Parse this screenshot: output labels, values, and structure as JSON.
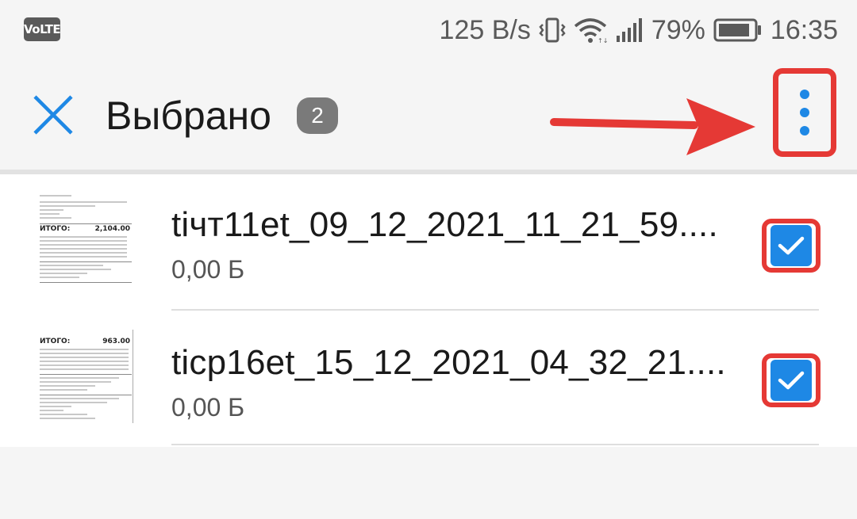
{
  "status_bar": {
    "volte": "VoLTE",
    "net_speed": "125 B/s",
    "battery_percent": "79%",
    "time": "16:35",
    "icons": [
      "vibrate-icon",
      "wifi-icon",
      "signal-icon",
      "battery-icon"
    ]
  },
  "toolbar": {
    "close_icon": "close-icon",
    "title": "Выбрано",
    "selected_count": "2",
    "more_icon": "more-vertical-icon",
    "annotation": "red-arrow-pointing-to-more-menu"
  },
  "files": [
    {
      "name": "tiчт11et_09_12_2021_11_21_59....",
      "size": "0,00 Б",
      "checked": true,
      "thumb": {
        "total_label": "ИТОГО:",
        "total_value": "2,104.00"
      }
    },
    {
      "name": "ticp16et_15_12_2021_04_32_21....",
      "size": "0,00 Б",
      "checked": true,
      "thumb": {
        "total_label": "ИТОГО:",
        "total_value": "963.00"
      }
    }
  ],
  "colors": {
    "accent": "#1e88e5",
    "highlight": "#e53935",
    "background": "#f5f5f5"
  }
}
